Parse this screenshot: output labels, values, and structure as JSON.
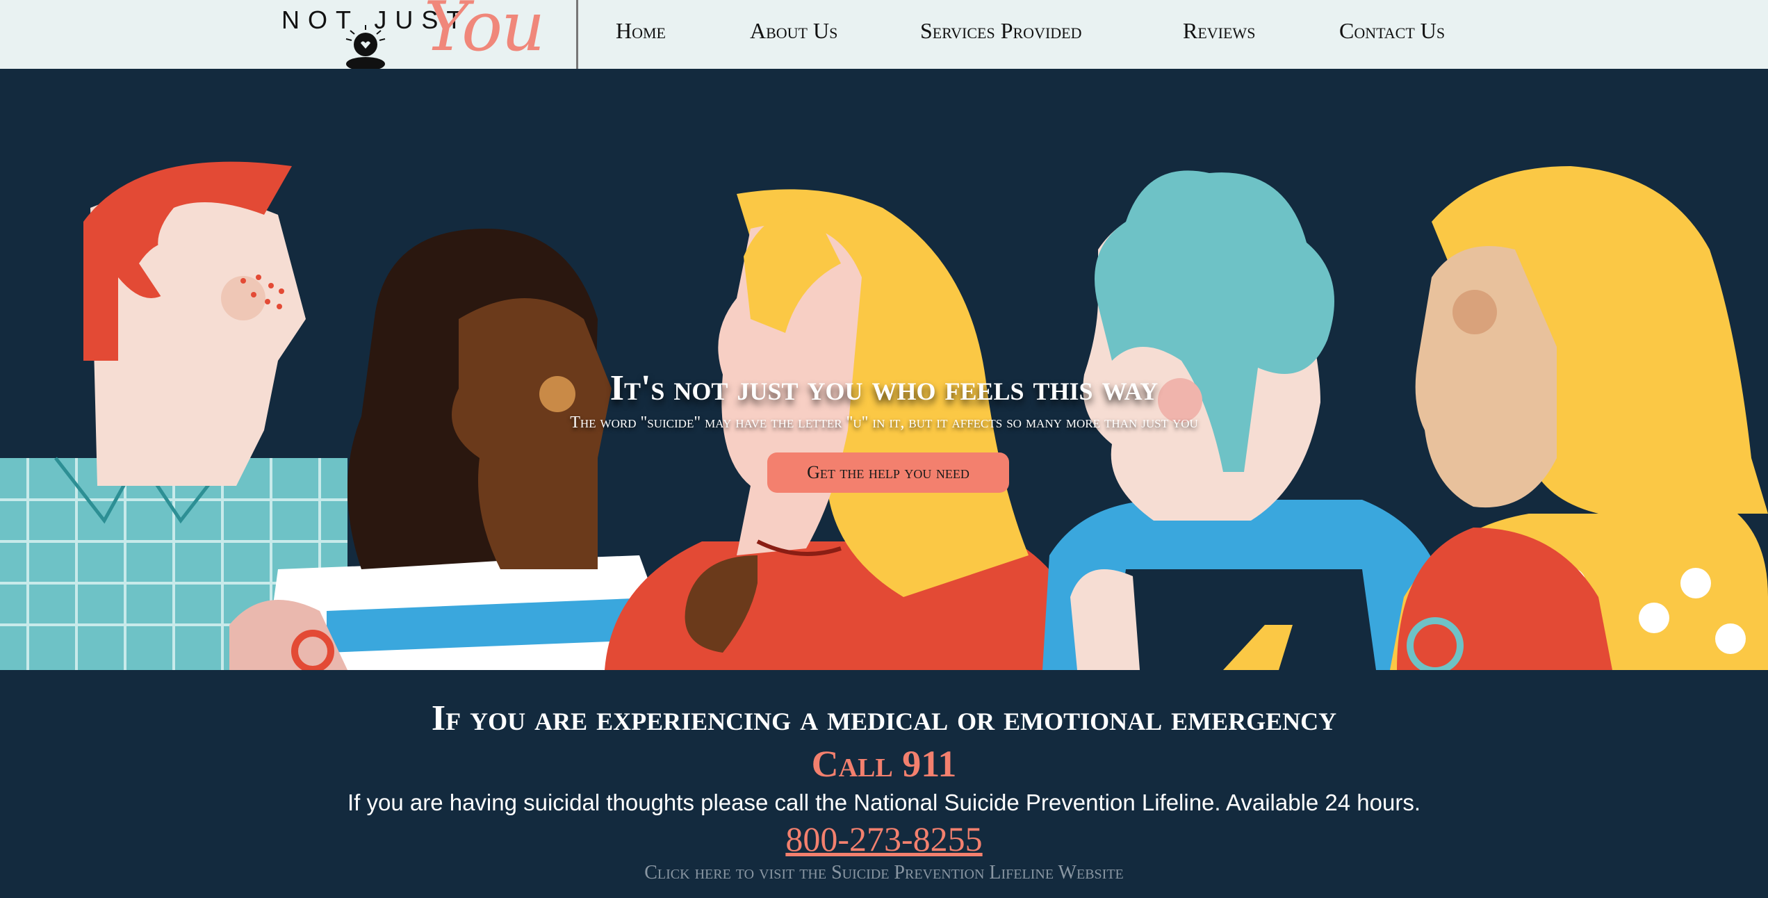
{
  "nav": {
    "logo_text": "NOT JUST",
    "logo_script": "You",
    "items": [
      "Home",
      "About Us",
      "Services Provided",
      "Reviews",
      "Contact Us"
    ]
  },
  "hero": {
    "title": "It's not just you who feels this way",
    "subtitle": "The word \"suicide\" may have the letter \"u\" in it, but it affects so many more than just you",
    "button_label": "Get the help you need"
  },
  "emergency": {
    "heading": "If you are experiencing a medical or emotional emergency",
    "call_label": "Call 911",
    "lifeline_text": "If you are having suicidal thoughts please call the National Suicide Prevention Lifeline. Available 24 hours.",
    "phone": "800-273-8255",
    "link_label": "Click here to visit the Suicide Prevention Lifeline Website"
  },
  "colors": {
    "nav_bg": "#e9f2f2",
    "dark_bg": "#132a3e",
    "accent": "#f3806e"
  }
}
